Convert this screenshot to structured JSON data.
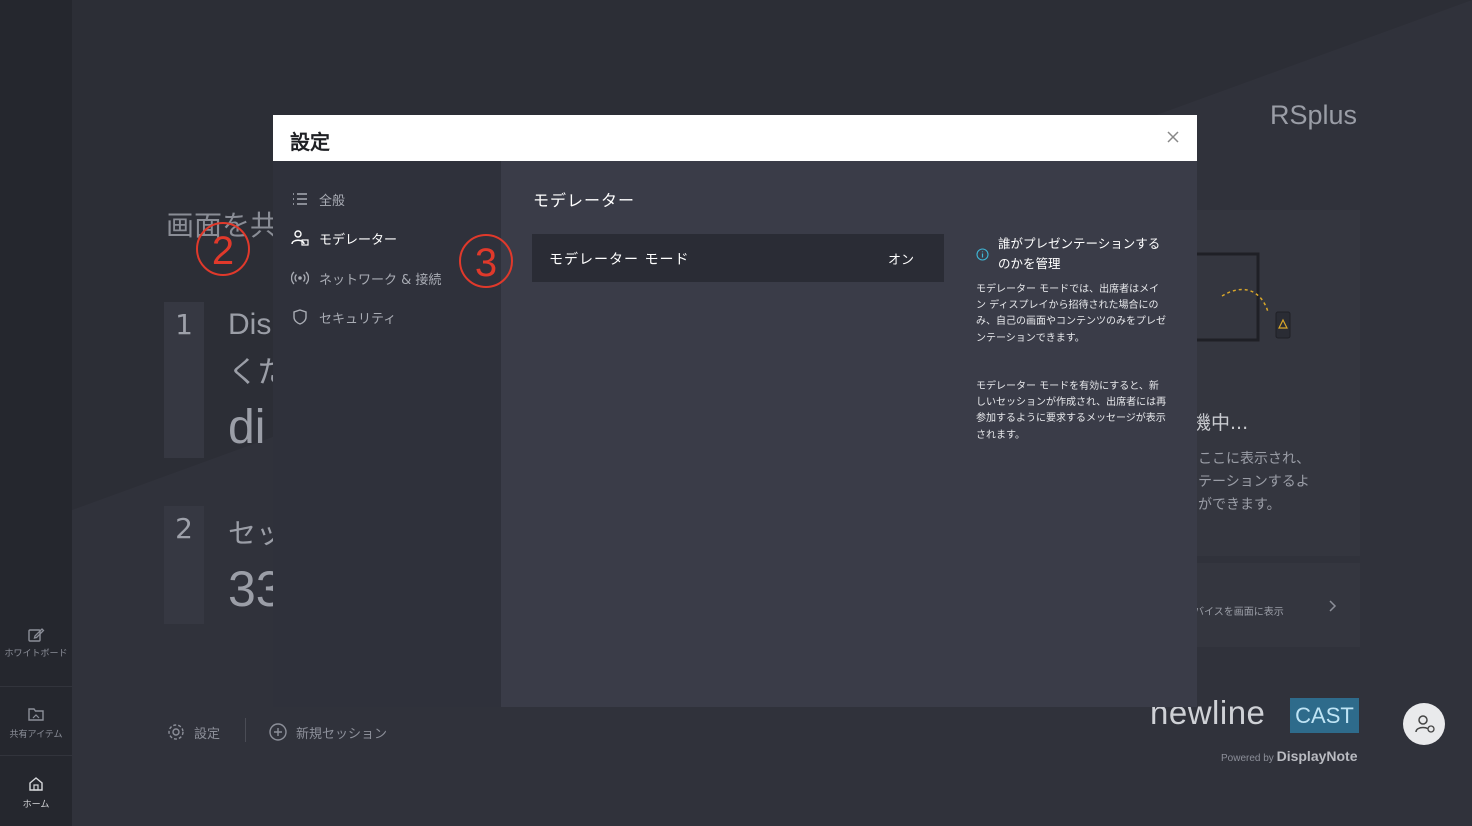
{
  "app": {
    "brand_top": "RSplus"
  },
  "rail": {
    "whiteboard_label": "ホワイトボード",
    "shared_items_label": "共有アイテム",
    "home_label": "ホーム"
  },
  "background": {
    "heading": "画面を共",
    "step1_number": "1",
    "step1_line1": "Dis",
    "step1_line2": "くだ",
    "step1_line3": "di",
    "step2_number": "2",
    "step2_line1": "セッ",
    "step2_line2": "33",
    "right_status": "機中...",
    "right_desc_1": "ここに表示され、",
    "right_desc_2": "テーションするよ",
    "right_desc_3": "ができます。",
    "right_link": "バイスを画面に表示",
    "settings_link": "設定",
    "new_session_link": "新規セッション",
    "brand_newline": "newline",
    "brand_cast": "CAST",
    "powered_by": "Powered by",
    "powered_brand": "DisplayNote"
  },
  "modal": {
    "title": "設定",
    "nav": [
      {
        "label": "全般"
      },
      {
        "label": "モデレーター"
      },
      {
        "label": "ネットワーク & 接続"
      },
      {
        "label": "セキュリティ"
      }
    ],
    "content_title": "モデレーター",
    "row_label": "モデレーター モード",
    "row_value": "オン",
    "help_title": "誰がプレゼンテーションするのかを管理",
    "help_p1": "モデレーター モードでは、出席者はメイン ディスプレイから招待された場合にのみ、自己の画面やコンテンツのみをプレゼンテーションできます。",
    "help_p2": "モデレーター モードを有効にすると、新しいセッションが作成され、出席者には再参加するように要求するメッセージが表示されます。"
  },
  "markers": {
    "m2": "2",
    "m3": "3"
  },
  "colors": {
    "marker_red": "#e0392b",
    "cast_blue": "#2e6b8b"
  }
}
